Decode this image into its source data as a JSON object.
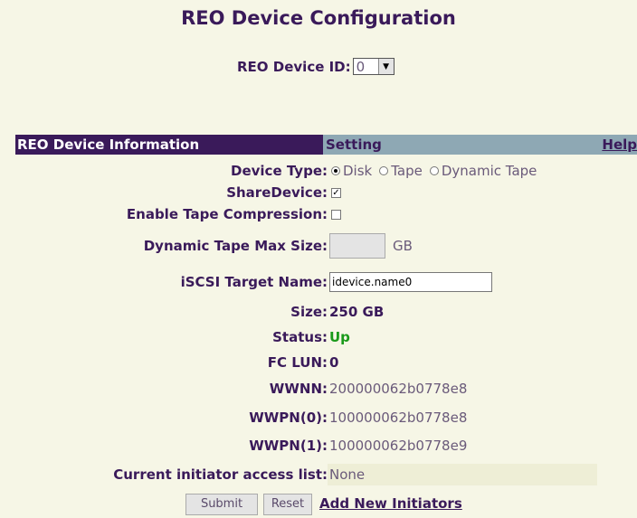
{
  "page": {
    "title": "REO Device Configuration"
  },
  "device_id": {
    "label": "REO Device ID:",
    "selected": "0"
  },
  "header": {
    "info": "REO Device Information",
    "setting": "Setting",
    "help": "Help"
  },
  "device_type": {
    "label": "Device Type:",
    "options": [
      "Disk",
      "Tape",
      "Dynamic Tape"
    ],
    "selected": "Disk"
  },
  "share_device": {
    "label": "ShareDevice:",
    "checked": true
  },
  "tape_compression": {
    "label": "Enable Tape Compression:",
    "checked": false
  },
  "dynamic_tape_max": {
    "label": "Dynamic Tape Max Size:",
    "value": "",
    "unit": "GB"
  },
  "iscsi_target": {
    "label": "iSCSI Target Name:",
    "value": "idevice.name0"
  },
  "size": {
    "label": "Size:",
    "value": "250 GB"
  },
  "status": {
    "label": "Status:",
    "value": "Up",
    "color": "#1a9a1a"
  },
  "fc_lun": {
    "label": "FC LUN:",
    "value": "0"
  },
  "wwnn": {
    "label": "WWNN:",
    "value": "200000062b0778e8"
  },
  "wwpn0": {
    "label": "WWPN(0):",
    "value": "100000062b0778e8"
  },
  "wwpn1": {
    "label": "WWPN(1):",
    "value": "100000062b0778e9"
  },
  "access_list": {
    "label": "Current initiator access list:",
    "value": "None"
  },
  "buttons": {
    "submit": "Submit",
    "reset": "Reset",
    "add_initiators": "Add New Initiators"
  },
  "colors": {
    "header_dark": "#3a1a5a",
    "header_light": "#8ea8b4",
    "background": "#f6f6e6"
  }
}
